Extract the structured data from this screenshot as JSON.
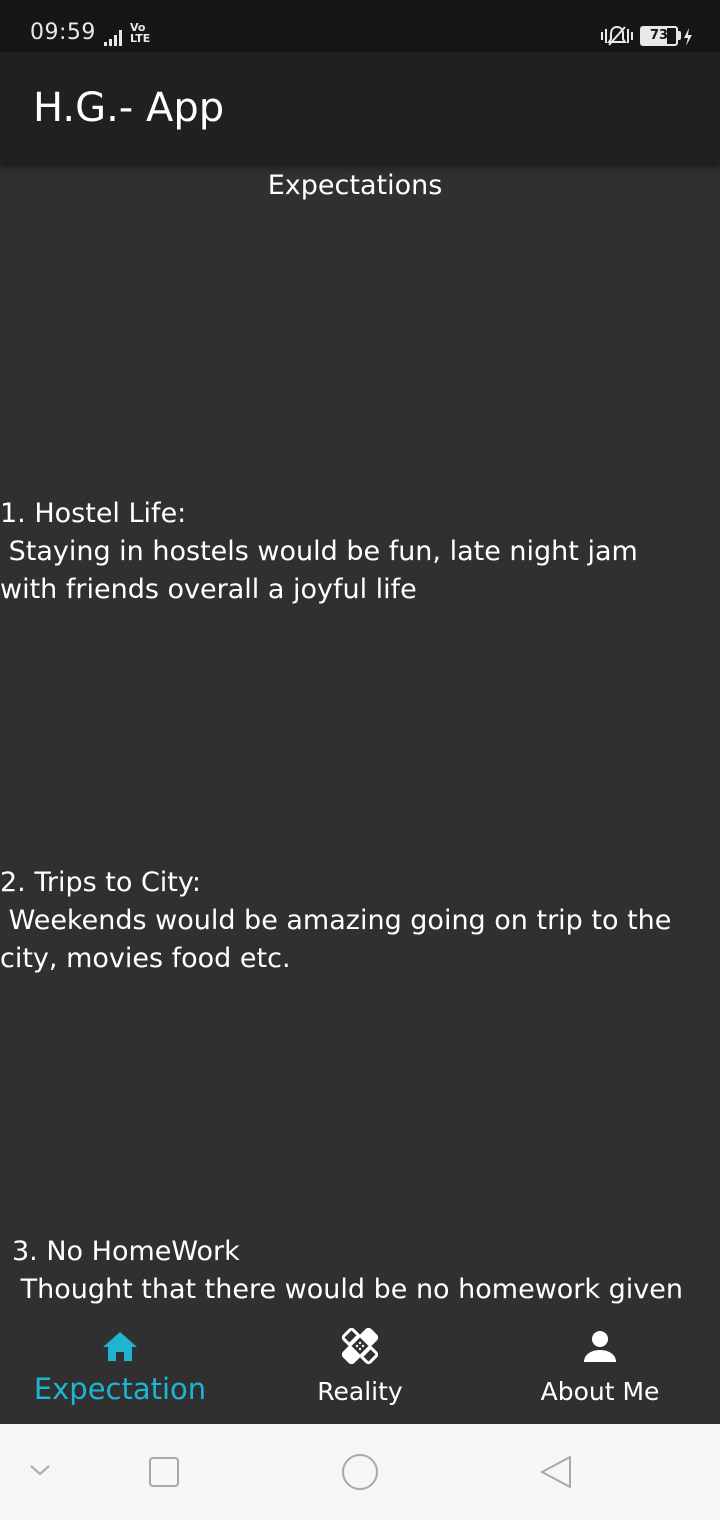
{
  "status_bar": {
    "time": "09:59",
    "network_label": "Vo LTE",
    "battery_percent": 73,
    "battery_text": "73",
    "icons": [
      "signal-icon",
      "volte-icon",
      "vibrate-icon",
      "battery-icon",
      "charging-icon"
    ]
  },
  "app_bar": {
    "title": "H.G.- App"
  },
  "content": {
    "heading": "Expectations",
    "items": [
      {
        "title": "1. Hostel Life:",
        "body": " Staying in hostels would be fun, late night jam\nwith friends overall a joyful life"
      },
      {
        "title": "2. Trips to City:",
        "body": " Weekends would be amazing going on trip to the\ncity, movies food etc."
      },
      {
        "title": "3. No HomeWork",
        "body": " Thought that there would be no homework given"
      }
    ]
  },
  "bottom_nav": {
    "items": [
      {
        "label": "Expectation",
        "icon": "home-icon",
        "active": true
      },
      {
        "label": "Reality",
        "icon": "bandage-icon",
        "active": false
      },
      {
        "label": "About Me",
        "icon": "person-icon",
        "active": false
      }
    ]
  },
  "system_nav": {
    "icons": [
      "chevron-down-icon",
      "recents-icon",
      "home-circle-icon",
      "back-icon"
    ]
  },
  "colors": {
    "background": "#303030",
    "app_bar": "#202020",
    "status_bar": "#161616",
    "accent": "#1eb4d2",
    "text": "#ffffff",
    "system_nav": "#f6f6f6"
  }
}
